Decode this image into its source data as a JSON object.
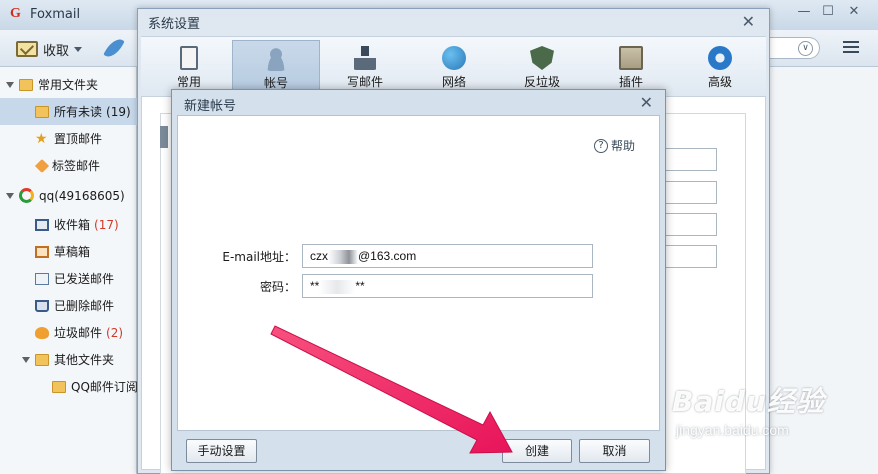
{
  "app": {
    "title": "Foxmail"
  },
  "toolbar": {
    "receive_label": "收取"
  },
  "sidebar": {
    "items": [
      {
        "label": "常用文件夹",
        "count": ""
      },
      {
        "label": "所有未读",
        "count": "(19)"
      },
      {
        "label": "置顶邮件",
        "count": ""
      },
      {
        "label": "标签邮件",
        "count": ""
      },
      {
        "label": "qq(49168605)",
        "count": ""
      },
      {
        "label": "收件箱",
        "count": "(17)"
      },
      {
        "label": "草稿箱",
        "count": ""
      },
      {
        "label": "已发送邮件",
        "count": ""
      },
      {
        "label": "已删除邮件",
        "count": ""
      },
      {
        "label": "垃圾邮件",
        "count": "(2)"
      },
      {
        "label": "其他文件夹",
        "count": ""
      },
      {
        "label": "QQ邮件订阅",
        "count": ""
      }
    ]
  },
  "settings": {
    "title": "系统设置",
    "tabs": [
      {
        "label": "常用"
      },
      {
        "label": "帐号"
      },
      {
        "label": "写邮件"
      },
      {
        "label": "网络"
      },
      {
        "label": "反垃圾"
      },
      {
        "label": "插件"
      },
      {
        "label": "高级"
      }
    ],
    "active_tab": "帐号"
  },
  "new_account": {
    "title": "新建帐号",
    "help_label": "帮助",
    "email_label": "E-mail地址：",
    "email_prefix": "czx",
    "email_suffix": "@163.com",
    "password_label": "密码：",
    "password_prefix": "**",
    "password_suffix": "**",
    "manual_button": "手动设置",
    "create_button": "创建",
    "cancel_button": "取消"
  },
  "watermark": {
    "main": "Baidu经验",
    "sub": "jingyan.baidu.com"
  },
  "colors": {
    "arrow": "#f0286a",
    "count": "#d03a2a",
    "selected": "#c6d8ea"
  }
}
